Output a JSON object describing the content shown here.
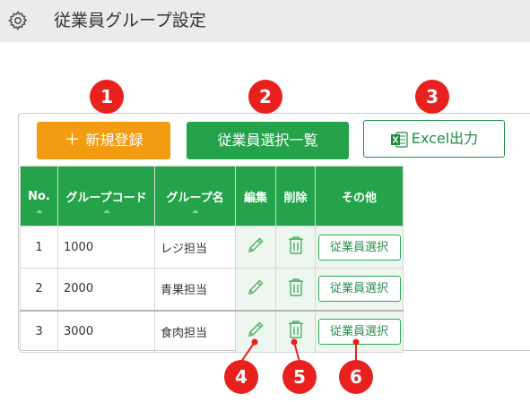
{
  "header": {
    "title": "従業員グループ設定",
    "icon": "gear-icon"
  },
  "toolbar": {
    "new_label": "新規登録",
    "new_icon": "plus-icon",
    "list_label": "従業員選択一覧",
    "excel_label": "Excel出力",
    "excel_icon": "excel-icon"
  },
  "table": {
    "columns": [
      "No.",
      "グループコード",
      "グループ名",
      "編集",
      "削除",
      "その他"
    ],
    "rows": [
      {
        "no": "1",
        "code": "1000",
        "name": "レジ担当",
        "select_label": "従業員選択"
      },
      {
        "no": "2",
        "code": "2000",
        "name": "青果担当",
        "select_label": "従業員選択"
      },
      {
        "no": "3",
        "code": "3000",
        "name": "食肉担当",
        "select_label": "従業員選択"
      }
    ]
  },
  "markers": [
    "1",
    "2",
    "3",
    "4",
    "5",
    "6"
  ],
  "colors": {
    "orange": "#f39c12",
    "green": "#24a34a",
    "marker_red": "#e8211f",
    "title_bg": "#ebebeb"
  }
}
